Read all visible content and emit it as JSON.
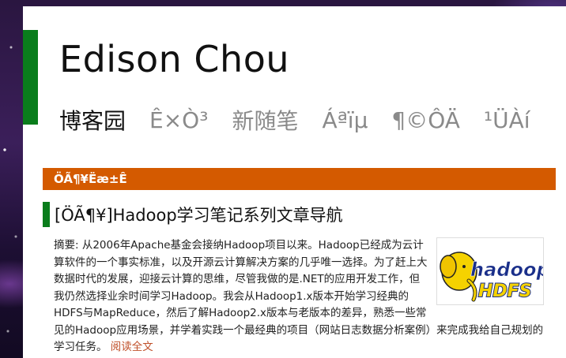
{
  "blog": {
    "title": "Edison Chou"
  },
  "nav": {
    "items": [
      {
        "label": "博客园"
      },
      {
        "label": "Ê×Ò³"
      },
      {
        "label": "新随笔"
      },
      {
        "label": "Áªïµ"
      },
      {
        "label": "¶©ÔÄ"
      },
      {
        "label": "¹ÜÀí"
      }
    ]
  },
  "section": {
    "header": "ÖÃ¶¥Ëæ±Ê"
  },
  "post": {
    "title": "[ÖÃ¶¥]Hadoop学习笔记系列文章导航",
    "summary": "摘要: 从2006年Apache基金会接纳Hadoop项目以来。Hadoop已经成为云计算软件的一个事实标准，以及开源云计算解决方案的几乎唯一选择。为了赶上大数据时代的发展，迎接云计算的思维，尽管我做的是.NET的应用开发工作，但我仍然选择业余时间学习Hadoop。我会从Hadoop1.x版本开始学习经典的HDFS与MapReduce，然后了解Hadoop2.x版本与老版本的差异，熟悉一些常见的Hadoop应用场景，并学着实践一个最经典的项目（网站日志数据分析案例）来完成我给自己规划的学习任务。",
    "read_more": "阅读全文",
    "image": {
      "word1": "hadoop",
      "word2": "HDFS"
    }
  },
  "colors": {
    "accent_green": "#0a7d1c",
    "header_orange": "#d45a00",
    "link": "#c0502a"
  }
}
